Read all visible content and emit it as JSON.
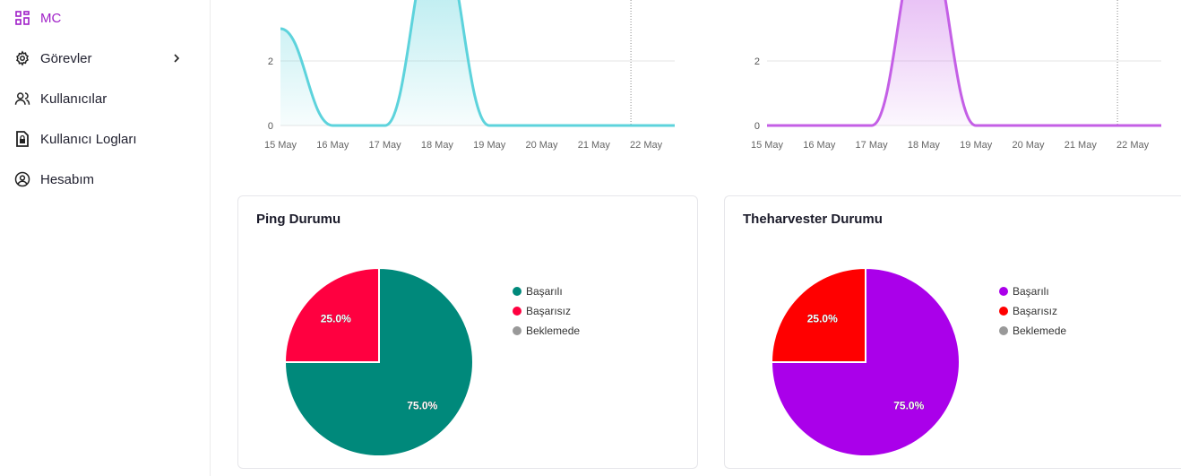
{
  "sidebar": {
    "items": [
      {
        "label": "MC",
        "icon": "dashboard-grid-icon",
        "active": true
      },
      {
        "label": "Görevler",
        "icon": "gear-icon",
        "has_submenu": true
      },
      {
        "label": "Kullanıcılar",
        "icon": "users-icon"
      },
      {
        "label": "Kullanıcı Logları",
        "icon": "log-document-icon"
      },
      {
        "label": "Hesabım",
        "icon": "account-circle-icon"
      }
    ]
  },
  "colors": {
    "accent": "#a020c8",
    "teal_line": "#5dd3dc",
    "purple_line": "#c45fe6",
    "ping_success": "#00897b",
    "ping_fail": "#ff0040",
    "harvester_success": "#aa00ea",
    "harvester_fail": "#ff0000",
    "pending": "#999999"
  },
  "chart_data": [
    {
      "type": "area",
      "x": [
        "15 May",
        "16 May",
        "17 May",
        "18 May",
        "19 May",
        "20 May",
        "21 May",
        "22 May"
      ],
      "y_ticks": [
        0,
        2
      ],
      "series": [
        {
          "values": [
            3,
            0,
            0,
            6,
            0,
            0,
            0,
            0
          ]
        }
      ],
      "color": "#5dd3dc"
    },
    {
      "type": "area",
      "x": [
        "15 May",
        "16 May",
        "17 May",
        "18 May",
        "19 May",
        "20 May",
        "21 May",
        "22 May"
      ],
      "y_ticks": [
        0,
        2
      ],
      "series": [
        {
          "values": [
            0,
            0,
            0,
            6,
            0,
            0,
            0,
            0
          ]
        }
      ],
      "color": "#c45fe6"
    },
    {
      "type": "pie",
      "title": "Ping Durumu",
      "slices": [
        {
          "label": "Başarılı",
          "value": 75.0,
          "display": "75.0%",
          "color": "#00897b"
        },
        {
          "label": "Başarısız",
          "value": 25.0,
          "display": "25.0%",
          "color": "#ff0040"
        },
        {
          "label": "Beklemede",
          "value": 0,
          "display": "",
          "color": "#999999"
        }
      ]
    },
    {
      "type": "pie",
      "title": "Theharvester Durumu",
      "slices": [
        {
          "label": "Başarılı",
          "value": 75.0,
          "display": "75.0%",
          "color": "#aa00ea"
        },
        {
          "label": "Başarısız",
          "value": 25.0,
          "display": "25.0%",
          "color": "#ff0000"
        },
        {
          "label": "Beklemede",
          "value": 0,
          "display": "",
          "color": "#999999"
        }
      ]
    }
  ]
}
